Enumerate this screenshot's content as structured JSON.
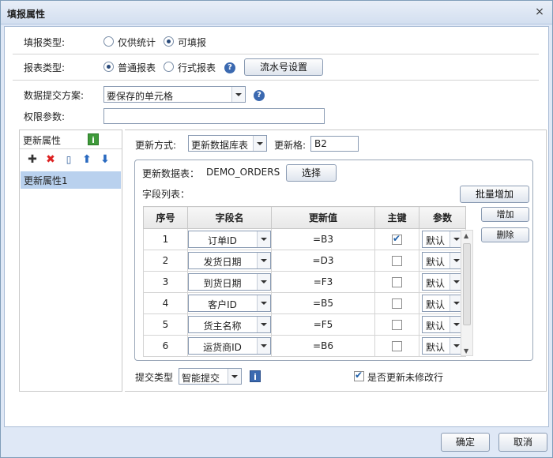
{
  "window": {
    "title": "填报属性",
    "close": "×"
  },
  "fill_type": {
    "label": "填报类型:",
    "options": [
      "仅供统计",
      "可填报"
    ],
    "selected": 1
  },
  "report_type": {
    "label": "报表类型:",
    "options": [
      "普通报表",
      "行式报表"
    ],
    "selected": 0,
    "help": "?",
    "serial_button": "流水号设置"
  },
  "submit_plan": {
    "label": "数据提交方案:",
    "value": "要保存的单元格",
    "help": "?"
  },
  "permission": {
    "label": "权限参数:",
    "value": ""
  },
  "left": {
    "title": "更新属性",
    "info": "i",
    "toolbar": {
      "add": "✚",
      "delete": "✖",
      "copy": "▯",
      "up": "⬆",
      "down": "⬇"
    },
    "items": [
      "更新属性1"
    ]
  },
  "update": {
    "mode_label": "更新方式:",
    "mode_value": "更新数据库表",
    "cell_label": "更新格:",
    "cell_value": "B2"
  },
  "group": {
    "table_label": "更新数据表：",
    "table_name": "DEMO_ORDERS",
    "select_button": "选择",
    "fields_label": "字段列表：",
    "batch_add": "批量增加",
    "add": "增加",
    "remove": "删除"
  },
  "grid": {
    "headers": [
      "序号",
      "字段名",
      "更新值",
      "主键",
      "参数"
    ],
    "rows": [
      {
        "no": "1",
        "field": "订单ID",
        "value": "=B3",
        "key": true,
        "param": "默认"
      },
      {
        "no": "2",
        "field": "发货日期",
        "value": "=D3",
        "key": false,
        "param": "默认"
      },
      {
        "no": "3",
        "field": "到货日期",
        "value": "=F3",
        "key": false,
        "param": "默认"
      },
      {
        "no": "4",
        "field": "客户ID",
        "value": "=B5",
        "key": false,
        "param": "默认"
      },
      {
        "no": "5",
        "field": "货主名称",
        "value": "=F5",
        "key": false,
        "param": "默认"
      },
      {
        "no": "6",
        "field": "运货商ID",
        "value": "=B6",
        "key": false,
        "param": "默认"
      }
    ]
  },
  "bottom": {
    "submit_type_label": "提交类型",
    "submit_type_value": "智能提交",
    "info": "i",
    "update_unmodified_label": "是否更新未修改行",
    "update_unmodified_checked": true
  },
  "footer": {
    "ok": "确定",
    "cancel": "取消"
  }
}
